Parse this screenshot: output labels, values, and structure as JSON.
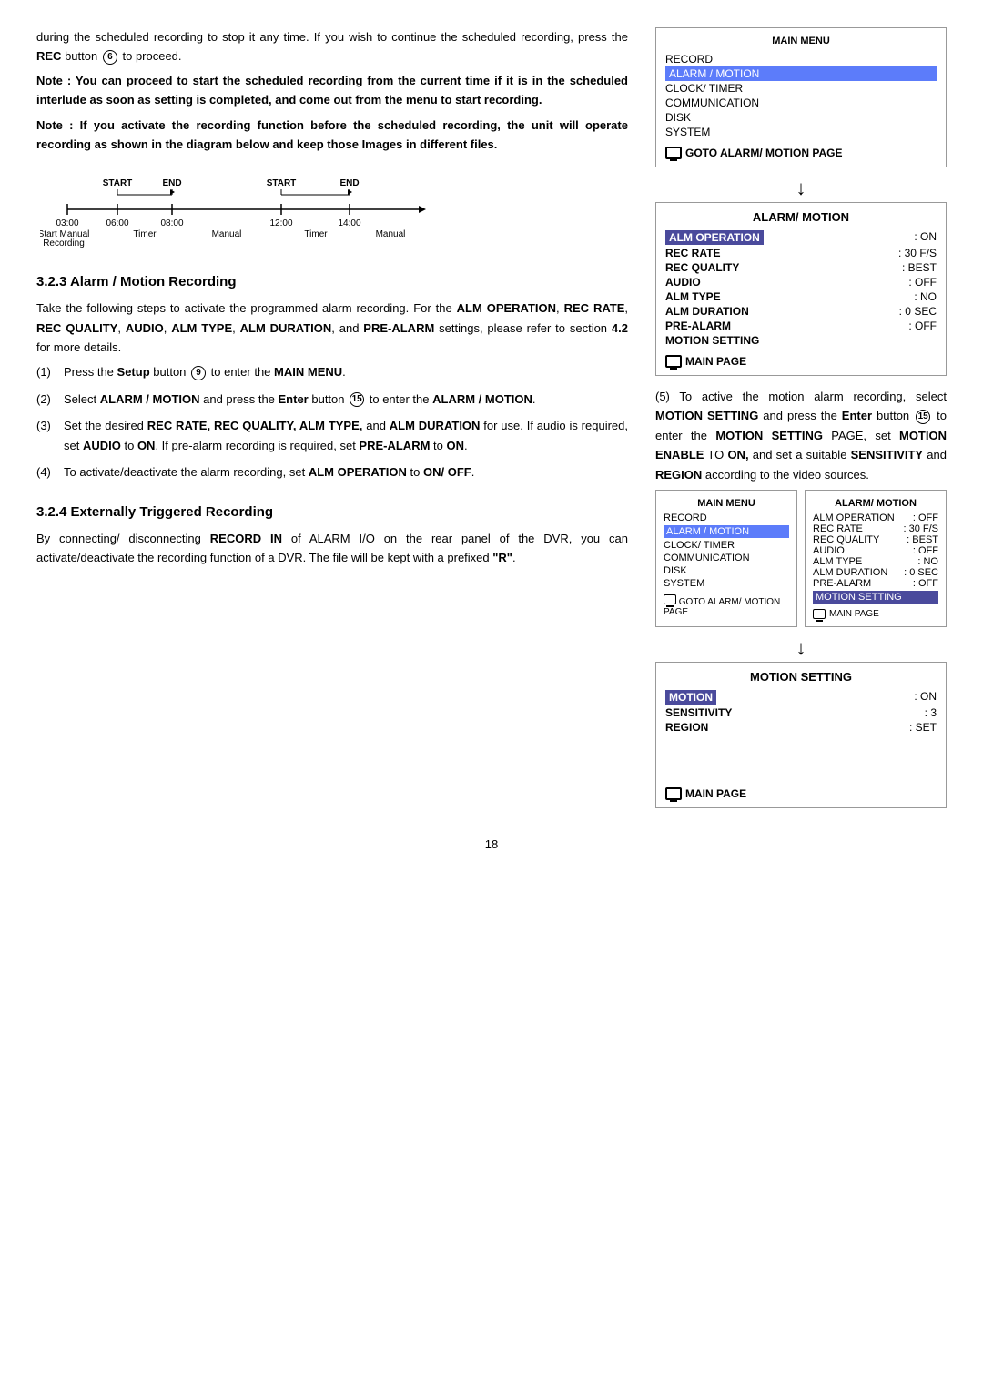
{
  "page": {
    "number": "18"
  },
  "intro_para1": "during the scheduled recording to stop it any time. If you wish to continue the scheduled recording, press the",
  "intro_rec": "REC",
  "intro_button": "button",
  "intro_circle6": "6",
  "intro_to": "to proceed.",
  "note1_label": "Note :",
  "note1_text": "You can proceed to start the scheduled recording from the current time if it is in the scheduled interlude as soon as setting is completed, and come out from the menu to start recording.",
  "note2_label": "Note :",
  "note2_text": "If you activate the recording function before the scheduled recording, the unit will operate recording as shown in the diagram below and keep those Images in different files.",
  "timeline": {
    "top_labels": [
      "START",
      "END",
      "",
      "START",
      "END"
    ],
    "times": [
      "03:00",
      "06:00",
      "08:00",
      "",
      "12:00",
      "14:00"
    ],
    "bottom_labels": [
      "Start Manual\nRecording",
      "",
      "Timer",
      "",
      "Manual",
      "",
      "Timer",
      "",
      "Manual"
    ]
  },
  "section323": {
    "heading": "3.2.3 Alarm / Motion Recording",
    "para1": "Take the following steps to activate the programmed alarm recording. For the",
    "para1_bold": "ALM OPERATION, REC RATE, REC QUALITY, AUDIO, ALM TYPE, ALM DURATION,",
    "para1_end": "and",
    "para1_bold2": "PRE-ALARM",
    "para1_end2": "settings, please refer to section",
    "para1_bold3": "4.2",
    "para1_end3": "for more details.",
    "steps": [
      {
        "num": "(1)",
        "text_pre": "Press the",
        "bold": "Setup",
        "text_mid": "button",
        "circle": "9",
        "text_end": "to enter the",
        "bold2": "MAIN MENU",
        "text_final": "."
      },
      {
        "num": "(2)",
        "text_pre": "Select",
        "bold": "ALARM / MOTION",
        "text_mid": "and press the",
        "bold2": "Enter",
        "text_mid2": "button",
        "circle": "15",
        "text_end": "to enter the",
        "bold3": "ALARM / MOTION",
        "text_final": "."
      },
      {
        "num": "(3)",
        "text_pre": "Set the desired",
        "bold": "REC RATE, REC QUALITY, ALM TYPE,",
        "text_mid": "and",
        "bold2": "ALM DURATION",
        "text_end": "for use. If audio is required, set",
        "bold3": "AUDIO",
        "text_end2": "to",
        "bold4": "ON",
        "text_end3": ". If pre-alarm recording is required, set",
        "bold5": "PRE-ALARM",
        "text_final": "to",
        "bold6": "ON",
        "text_last": "."
      },
      {
        "num": "(4)",
        "text_pre": "To activate/deactivate the alarm recording, set",
        "bold": "ALM OPERATION",
        "text_end": "to",
        "bold2": "ON/ OFF",
        "text_final": "."
      },
      {
        "num": "(5)",
        "text_pre": "To active the motion alarm recording, select",
        "bold": "MOTION SETTING",
        "text_mid": "and press the",
        "bold2": "Enter",
        "text_mid2": "button",
        "circle": "15",
        "text_end": "to enter the",
        "bold3": "MOTION SETTING",
        "text_end2": "PAGE, set",
        "bold4": "MOTION ENABLE",
        "text_end3": "TO",
        "bold5": "ON,",
        "text_end4": "and set a suitable",
        "bold6": "SENSITIVITY",
        "text_end5": "and",
        "bold7": "REGION",
        "text_final": "according to the video sources."
      }
    ]
  },
  "main_menu_box1": {
    "title": "MAIN MENU",
    "items": [
      "RECORD",
      "ALARM / MOTION",
      "CLOCK/ TIMER",
      "COMMUNICATION",
      "DISK",
      "SYSTEM"
    ],
    "highlighted": "ALARM / MOTION",
    "footer": "GOTO ALARM/ MOTION PAGE"
  },
  "alarm_motion_box": {
    "title": "ALARM/ MOTION",
    "items": [
      {
        "label": "ALM OPERATION",
        "value": ": ON",
        "highlighted": true
      },
      {
        "label": "REC RATE",
        "value": ": 30 F/S"
      },
      {
        "label": "REC QUALITY",
        "value": ": BEST"
      },
      {
        "label": "AUDIO",
        "value": ": OFF"
      },
      {
        "label": "ALM TYPE",
        "value": ": NO"
      },
      {
        "label": "ALM DURATION",
        "value": ": 0 SEC"
      },
      {
        "label": "PRE-ALARM",
        "value": ": OFF"
      },
      {
        "label": "MOTION SETTING",
        "value": ""
      }
    ],
    "footer": "MAIN PAGE"
  },
  "dual_panel": {
    "left": {
      "title": "MAIN MENU",
      "items": [
        "RECORD",
        "ALARM / MOTION",
        "CLOCK/ TIMER",
        "COMMUNICATION",
        "DISK",
        "SYSTEM"
      ],
      "highlighted": "ALARM / MOTION",
      "footer": "GOTO ALARM/ MOTION PAGE"
    },
    "right": {
      "title": "ALARM/ MOTION",
      "items": [
        {
          "label": "ALM OPERATION",
          "value": ": OFF"
        },
        {
          "label": "REC RATE",
          "value": ": 30 F/S"
        },
        {
          "label": "REC QUALITY",
          "value": ": BEST"
        },
        {
          "label": "AUDIO",
          "value": ": OFF"
        },
        {
          "label": "ALM TYPE",
          "value": ": NO"
        },
        {
          "label": "ALM DURATION",
          "value": ": 0 SEC"
        },
        {
          "label": "PRE-ALARM",
          "value": ": OFF"
        }
      ],
      "highlighted2": "MOTION SETTING",
      "footer": "MAIN PAGE"
    }
  },
  "motion_setting_box": {
    "title": "MOTION SETTING",
    "items": [
      {
        "label": "MOTION",
        "value": ": ON",
        "highlighted": true
      },
      {
        "label": "SENSITIVITY",
        "value": ":  3"
      },
      {
        "label": "REGION",
        "value": ": SET"
      }
    ],
    "footer": "MAIN PAGE"
  },
  "section324": {
    "heading": "3.2.4 Externally Triggered Recording",
    "para1": "By connecting/ disconnecting",
    "para1_bold": "RECORD IN",
    "para1_mid": "of ALARM I/O on the rear panel of the DVR, you can activate/deactivate the recording function of a DVR. The file will be kept with a prefixed",
    "para1_bold2": "“R”",
    "para1_end": "."
  }
}
